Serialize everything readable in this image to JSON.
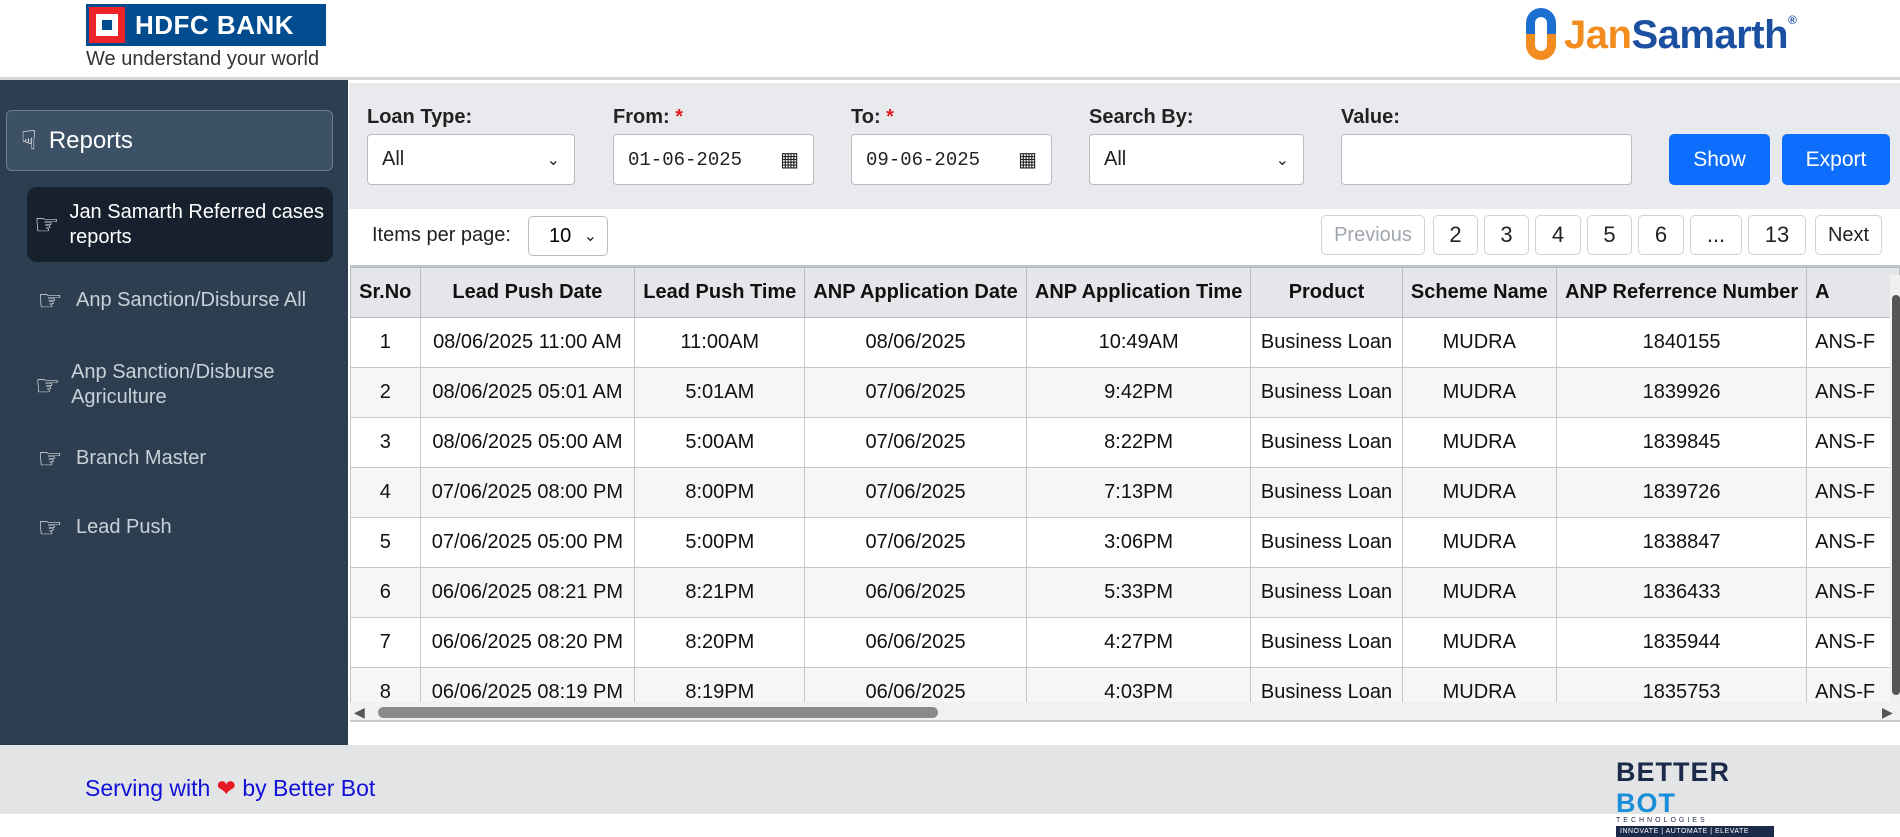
{
  "header": {
    "bank_name": "HDFC BANK",
    "bank_tagline": "We understand your world",
    "brand_jan": "Jan",
    "brand_samarth": "Samarth",
    "brand_reg": "®"
  },
  "sidebar": {
    "reports_label": "Reports",
    "items": [
      {
        "label": "Jan Samarth Referred cases reports",
        "active": true
      },
      {
        "label": "Anp Sanction/Disburse All"
      },
      {
        "label": "Anp Sanction/Disburse Agriculture"
      },
      {
        "label": "Branch Master"
      },
      {
        "label": "Lead Push"
      }
    ]
  },
  "filters": {
    "loan_type_label": "Loan Type:",
    "loan_type_value": "All",
    "from_label": "From:",
    "from_value": "01-06-2025",
    "to_label": "To:",
    "to_value": "09-06-2025",
    "required_mark": "*",
    "search_by_label": "Search By:",
    "search_by_value": "All",
    "value_label": "Value:",
    "value_input": "",
    "show_label": "Show",
    "export_label": "Export"
  },
  "pagination": {
    "items_per_page_label": "Items per page:",
    "items_per_page_value": "10",
    "previous_label": "Previous",
    "pages": [
      "2",
      "3",
      "4",
      "5",
      "6",
      "...",
      "13"
    ],
    "next_label": "Next"
  },
  "table": {
    "columns": [
      "Sr.No",
      "Lead Push Date",
      "Lead Push Time",
      "ANP Application Date",
      "ANP Application Time",
      "Product",
      "Scheme Name",
      "ANP Referrence Number",
      "A"
    ],
    "rows": [
      [
        "1",
        "08/06/2025 11:00 AM",
        "11:00AM",
        "08/06/2025",
        "10:49AM",
        "Business Loan",
        "MUDRA",
        "1840155",
        "ANS-F"
      ],
      [
        "2",
        "08/06/2025 05:01 AM",
        "5:01AM",
        "07/06/2025",
        "9:42PM",
        "Business Loan",
        "MUDRA",
        "1839926",
        "ANS-F"
      ],
      [
        "3",
        "08/06/2025 05:00 AM",
        "5:00AM",
        "07/06/2025",
        "8:22PM",
        "Business Loan",
        "MUDRA",
        "1839845",
        "ANS-F"
      ],
      [
        "4",
        "07/06/2025 08:00 PM",
        "8:00PM",
        "07/06/2025",
        "7:13PM",
        "Business Loan",
        "MUDRA",
        "1839726",
        "ANS-F"
      ],
      [
        "5",
        "07/06/2025 05:00 PM",
        "5:00PM",
        "07/06/2025",
        "3:06PM",
        "Business Loan",
        "MUDRA",
        "1838847",
        "ANS-F"
      ],
      [
        "6",
        "06/06/2025 08:21 PM",
        "8:21PM",
        "06/06/2025",
        "5:33PM",
        "Business Loan",
        "MUDRA",
        "1836433",
        "ANS-F"
      ],
      [
        "7",
        "06/06/2025 08:20 PM",
        "8:20PM",
        "06/06/2025",
        "4:27PM",
        "Business Loan",
        "MUDRA",
        "1835944",
        "ANS-F"
      ],
      [
        "8",
        "06/06/2025 08:19 PM",
        "8:19PM",
        "06/06/2025",
        "4:03PM",
        "Business Loan",
        "MUDRA",
        "1835753",
        "ANS-F"
      ]
    ]
  },
  "footer": {
    "serving_prefix": "Serving with",
    "heart": "❤",
    "serving_suffix": "by Better Bot",
    "bb_better": "BETTER",
    "bb_bot": "BOT",
    "bb_technologies": "TECHNOLOGIES",
    "bb_strip": "INNOVATE | AUTOMATE | ELEVATE"
  },
  "colors": {
    "sidebar_bg": "#2c3e50",
    "primary_button": "#0d6efd",
    "hdfc_blue": "#004c8f",
    "hdfc_red": "#ed232a",
    "footer_link": "#1010d6"
  },
  "icons": {
    "reports": "hand-pointing-icon",
    "nav_item": "hand-pointing-right-icon",
    "calendar": "calendar-icon",
    "dropdown": "chevron-down-icon"
  }
}
